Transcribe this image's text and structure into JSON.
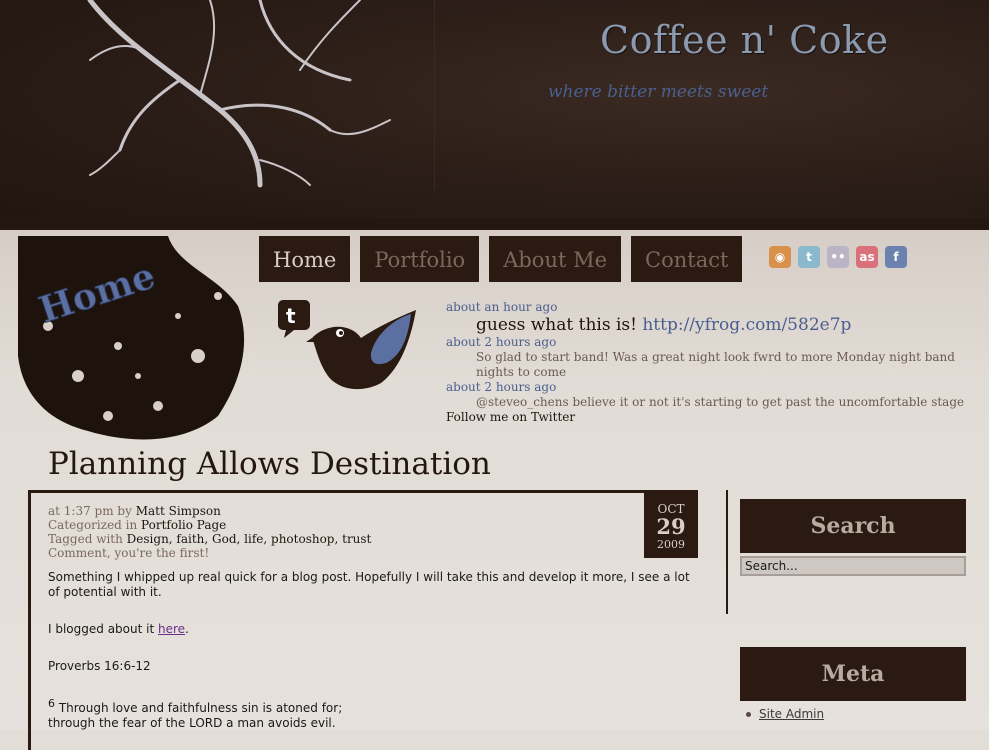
{
  "site": {
    "title": "Coffee n' Coke",
    "tagline": "where bitter meets sweet"
  },
  "badge": {
    "label": "Home"
  },
  "nav": {
    "items": [
      {
        "label": "Home",
        "active": true
      },
      {
        "label": "Portfolio",
        "active": false
      },
      {
        "label": "About Me",
        "active": false
      },
      {
        "label": "Contact",
        "active": false
      }
    ]
  },
  "social": [
    {
      "icon": "rss-icon",
      "color": "#d9904a",
      "glyph": "◉"
    },
    {
      "icon": "twitter-icon",
      "color": "#8ab8cc",
      "glyph": "t"
    },
    {
      "icon": "flickr-icon",
      "color": "#b9b4c6",
      "glyph": "••"
    },
    {
      "icon": "lastfm-icon",
      "color": "#d9707a",
      "glyph": "as"
    },
    {
      "icon": "facebook-icon",
      "color": "#6c82ae",
      "glyph": "f"
    }
  ],
  "twitter": {
    "tweets": [
      {
        "time": "about an hour ago",
        "text": "guess what this is! ",
        "link": "http://yfrog.com/582e7p"
      },
      {
        "time": "about 2 hours ago",
        "text": "So glad to start band! Was a great night look fwrd to more Monday night band nights to come"
      },
      {
        "time": "about 2 hours ago",
        "text": "@steveo_chens believe it or not it's starting to get past the uncomfortable stage"
      }
    ],
    "follow": "Follow me on Twitter"
  },
  "post": {
    "title": "Planning Allows Destination",
    "time_prefix": "at 1:37 pm by ",
    "author": "Matt Simpson",
    "cat_prefix": "Categorized in ",
    "category": "Portfolio Page",
    "tag_prefix": "Tagged with ",
    "tags": "Design, faith, God, life, photoshop, trust",
    "comment": "Comment, you're the first!",
    "date": {
      "month": "OCT",
      "day": "29",
      "year": "2009"
    },
    "p1": "Something I whipped up real quick for a blog post.  Hopefully I will take this and develop it more, I see a lot of potential with it.",
    "p2_prefix": "I blogged about it ",
    "p2_link": "here",
    "p2_suffix": ".",
    "p3": "Proverbs 16:6-12",
    "verse_num": "6",
    "verse_line1": " Through love and faithfulness sin is atoned for;",
    "verse_line2": "through the fear of the LORD a man avoids evil."
  },
  "sidebar": {
    "search_title": "Search",
    "search_value": "Search...",
    "meta_title": "Meta",
    "meta_items": [
      "Site Admin"
    ]
  }
}
